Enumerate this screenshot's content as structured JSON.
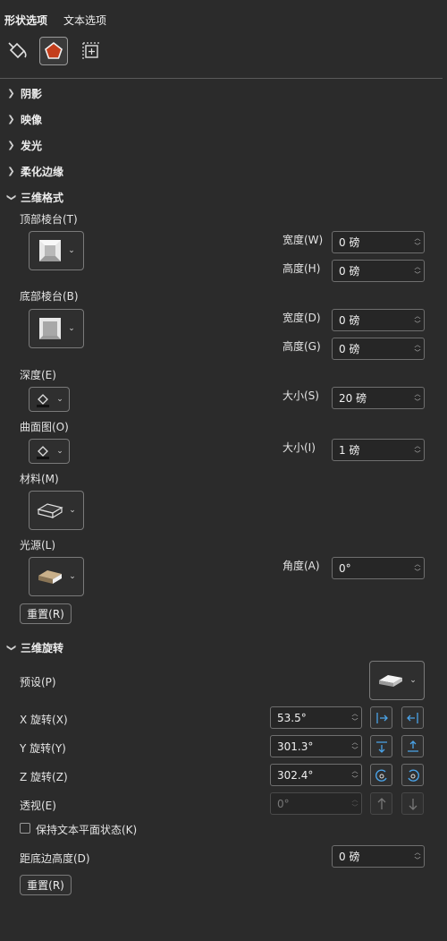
{
  "tabs": {
    "shape_options": "形状选项",
    "text_options": "文本选项"
  },
  "sections": {
    "shadow": "阴影",
    "reflection": "映像",
    "glow": "发光",
    "soft_edges": "柔化边缘",
    "format_3d": "三维格式",
    "rotation_3d": "三维旋转"
  },
  "format3d": {
    "top_bevel": "顶部棱台(T)",
    "bottom_bevel": "底部棱台(B)",
    "width_w": "宽度(W)",
    "height_h": "高度(H)",
    "width_d": "宽度(D)",
    "height_g": "高度(G)",
    "top_width": "0 磅",
    "top_height": "0 磅",
    "bottom_width": "0 磅",
    "bottom_height": "0 磅",
    "depth": "深度(E)",
    "size_s": "大小(S)",
    "depth_size": "20 磅",
    "contour": "曲面图(O)",
    "size_i": "大小(I)",
    "contour_size": "1 磅",
    "material": "材料(M)",
    "lighting": "光源(L)",
    "angle": "角度(A)",
    "angle_value": "0°",
    "reset": "重置(R)"
  },
  "rotation": {
    "presets": "预设(P)",
    "x_label": "X 旋转(X)",
    "x_value": "53.5°",
    "y_label": "Y 旋转(Y)",
    "y_value": "301.3°",
    "z_label": "Z 旋转(Z)",
    "z_value": "302.4°",
    "perspective": "透视(E)",
    "perspective_value": "0°",
    "keep_text_flat": "保持文本平面状态(K)",
    "distance": "距底边高度(D)",
    "distance_value": "0 磅",
    "reset": "重置(R)"
  },
  "colors": {
    "accent_fill": "#c43e1c",
    "rotate_icon_blue": "#4aa3e8"
  },
  "icons": [
    "fill-line-icon",
    "effects-pentagon-icon",
    "size-properties-icon"
  ]
}
